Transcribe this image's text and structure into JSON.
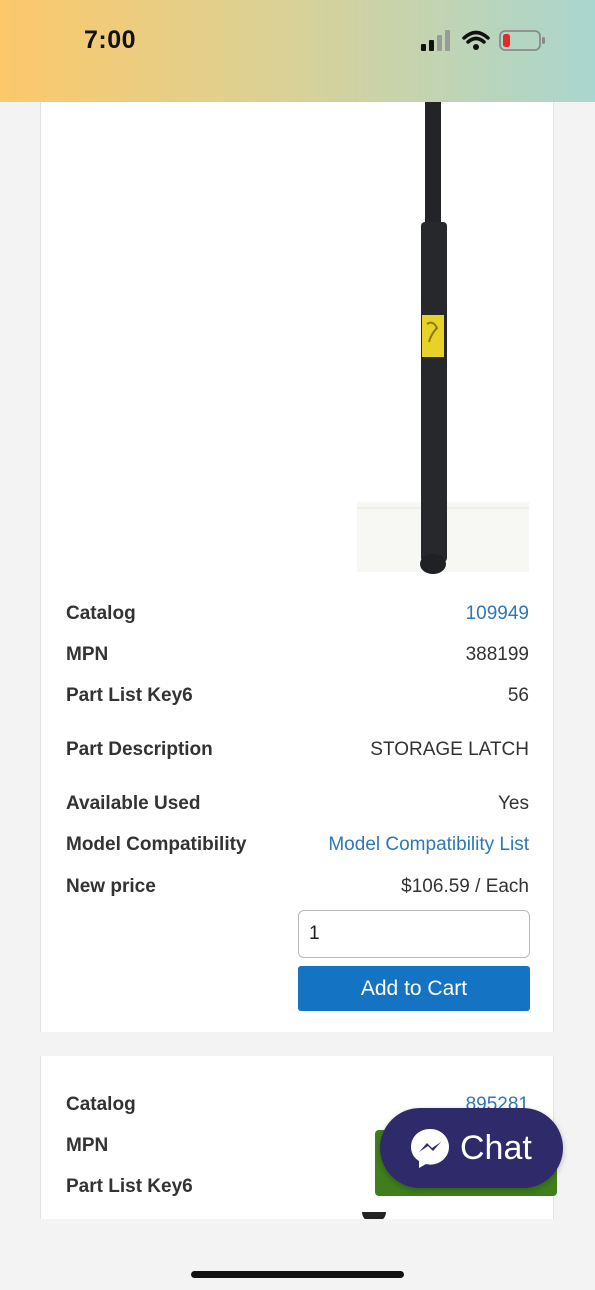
{
  "status_bar": {
    "time": "7:00"
  },
  "product_1": {
    "catalog_label": "Catalog",
    "catalog_value": "109949",
    "mpn_label": "MPN",
    "mpn_value": "388199",
    "part_list_key_label": "Part List Key6",
    "part_list_key_value": "56",
    "description_label": "Part Description",
    "description_value": "STORAGE LATCH",
    "available_used_label": "Available Used",
    "available_used_value": "Yes",
    "model_compat_label": "Model Compatibility",
    "model_compat_value": "Model Compatibility List",
    "new_price_label": "New price",
    "new_price_value": "$106.59 / Each",
    "quantity_value": "1",
    "add_to_cart_label": "Add to Cart"
  },
  "product_2": {
    "catalog_label": "Catalog",
    "catalog_value": "895281",
    "mpn_label": "MPN",
    "part_list_key_label": "Part List Key6"
  },
  "chat": {
    "label": "Chat"
  },
  "colors": {
    "link": "#2e77b8",
    "primary_button": "#1473c3",
    "chat_button": "#2f2b6b",
    "green_button": "#3f7d1d"
  },
  "icons": [
    "signal-icon",
    "wifi-icon",
    "battery-icon",
    "messenger-icon"
  ]
}
